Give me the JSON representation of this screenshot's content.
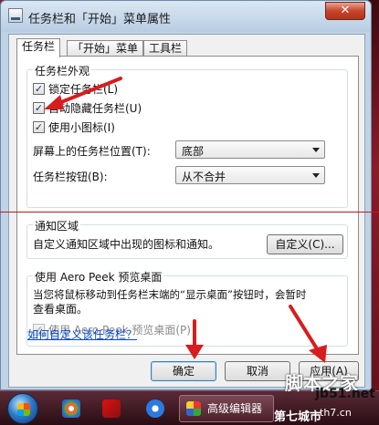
{
  "window": {
    "title": "任务栏和「开始」菜单属性",
    "close_label": "✕"
  },
  "tabs": [
    {
      "label": "任务栏",
      "active": true
    },
    {
      "label": "「开始」菜单",
      "active": false
    },
    {
      "label": "工具栏",
      "active": false
    }
  ],
  "appearance": {
    "title": "任务栏外观",
    "lock": {
      "label": "锁定任务栏(L)",
      "checked": true
    },
    "autohide": {
      "label": "自动隐藏任务栏(U)",
      "checked": true
    },
    "small_icons": {
      "label": "使用小图标(I)",
      "checked": true
    },
    "position": {
      "label": "屏幕上的任务栏位置(T):",
      "value": "底部"
    },
    "buttons": {
      "label": "任务栏按钮(B):",
      "value": "从不合并"
    }
  },
  "notification": {
    "title": "通知区域",
    "desc": "自定义通知区域中出现的图标和通知。",
    "customize_button": "自定义(C)..."
  },
  "aero": {
    "title": "使用 Aero Peek 预览桌面",
    "desc_line1": "当您将鼠标移动到任务栏末端的“显示桌面”按钮时，会暂时",
    "desc_line2": "查看桌面。",
    "checkbox": {
      "label": "使用 Aero Peek 预览桌面(P)",
      "checked": true,
      "enabled": false
    }
  },
  "help_link": "如何自定义该任务栏？",
  "buttons": {
    "ok": "确定",
    "cancel": "取消",
    "apply": "应用(A)"
  },
  "taskbar": {
    "task_label": "高级编辑器"
  },
  "watermarks": {
    "site": "jb51.net",
    "big": "脚本之家",
    "bottom_left": "第七城市",
    "bottom_right": "th7.cn"
  },
  "colors": {
    "annotation_red": "#d91c1c",
    "link_blue": "#0046d5"
  }
}
